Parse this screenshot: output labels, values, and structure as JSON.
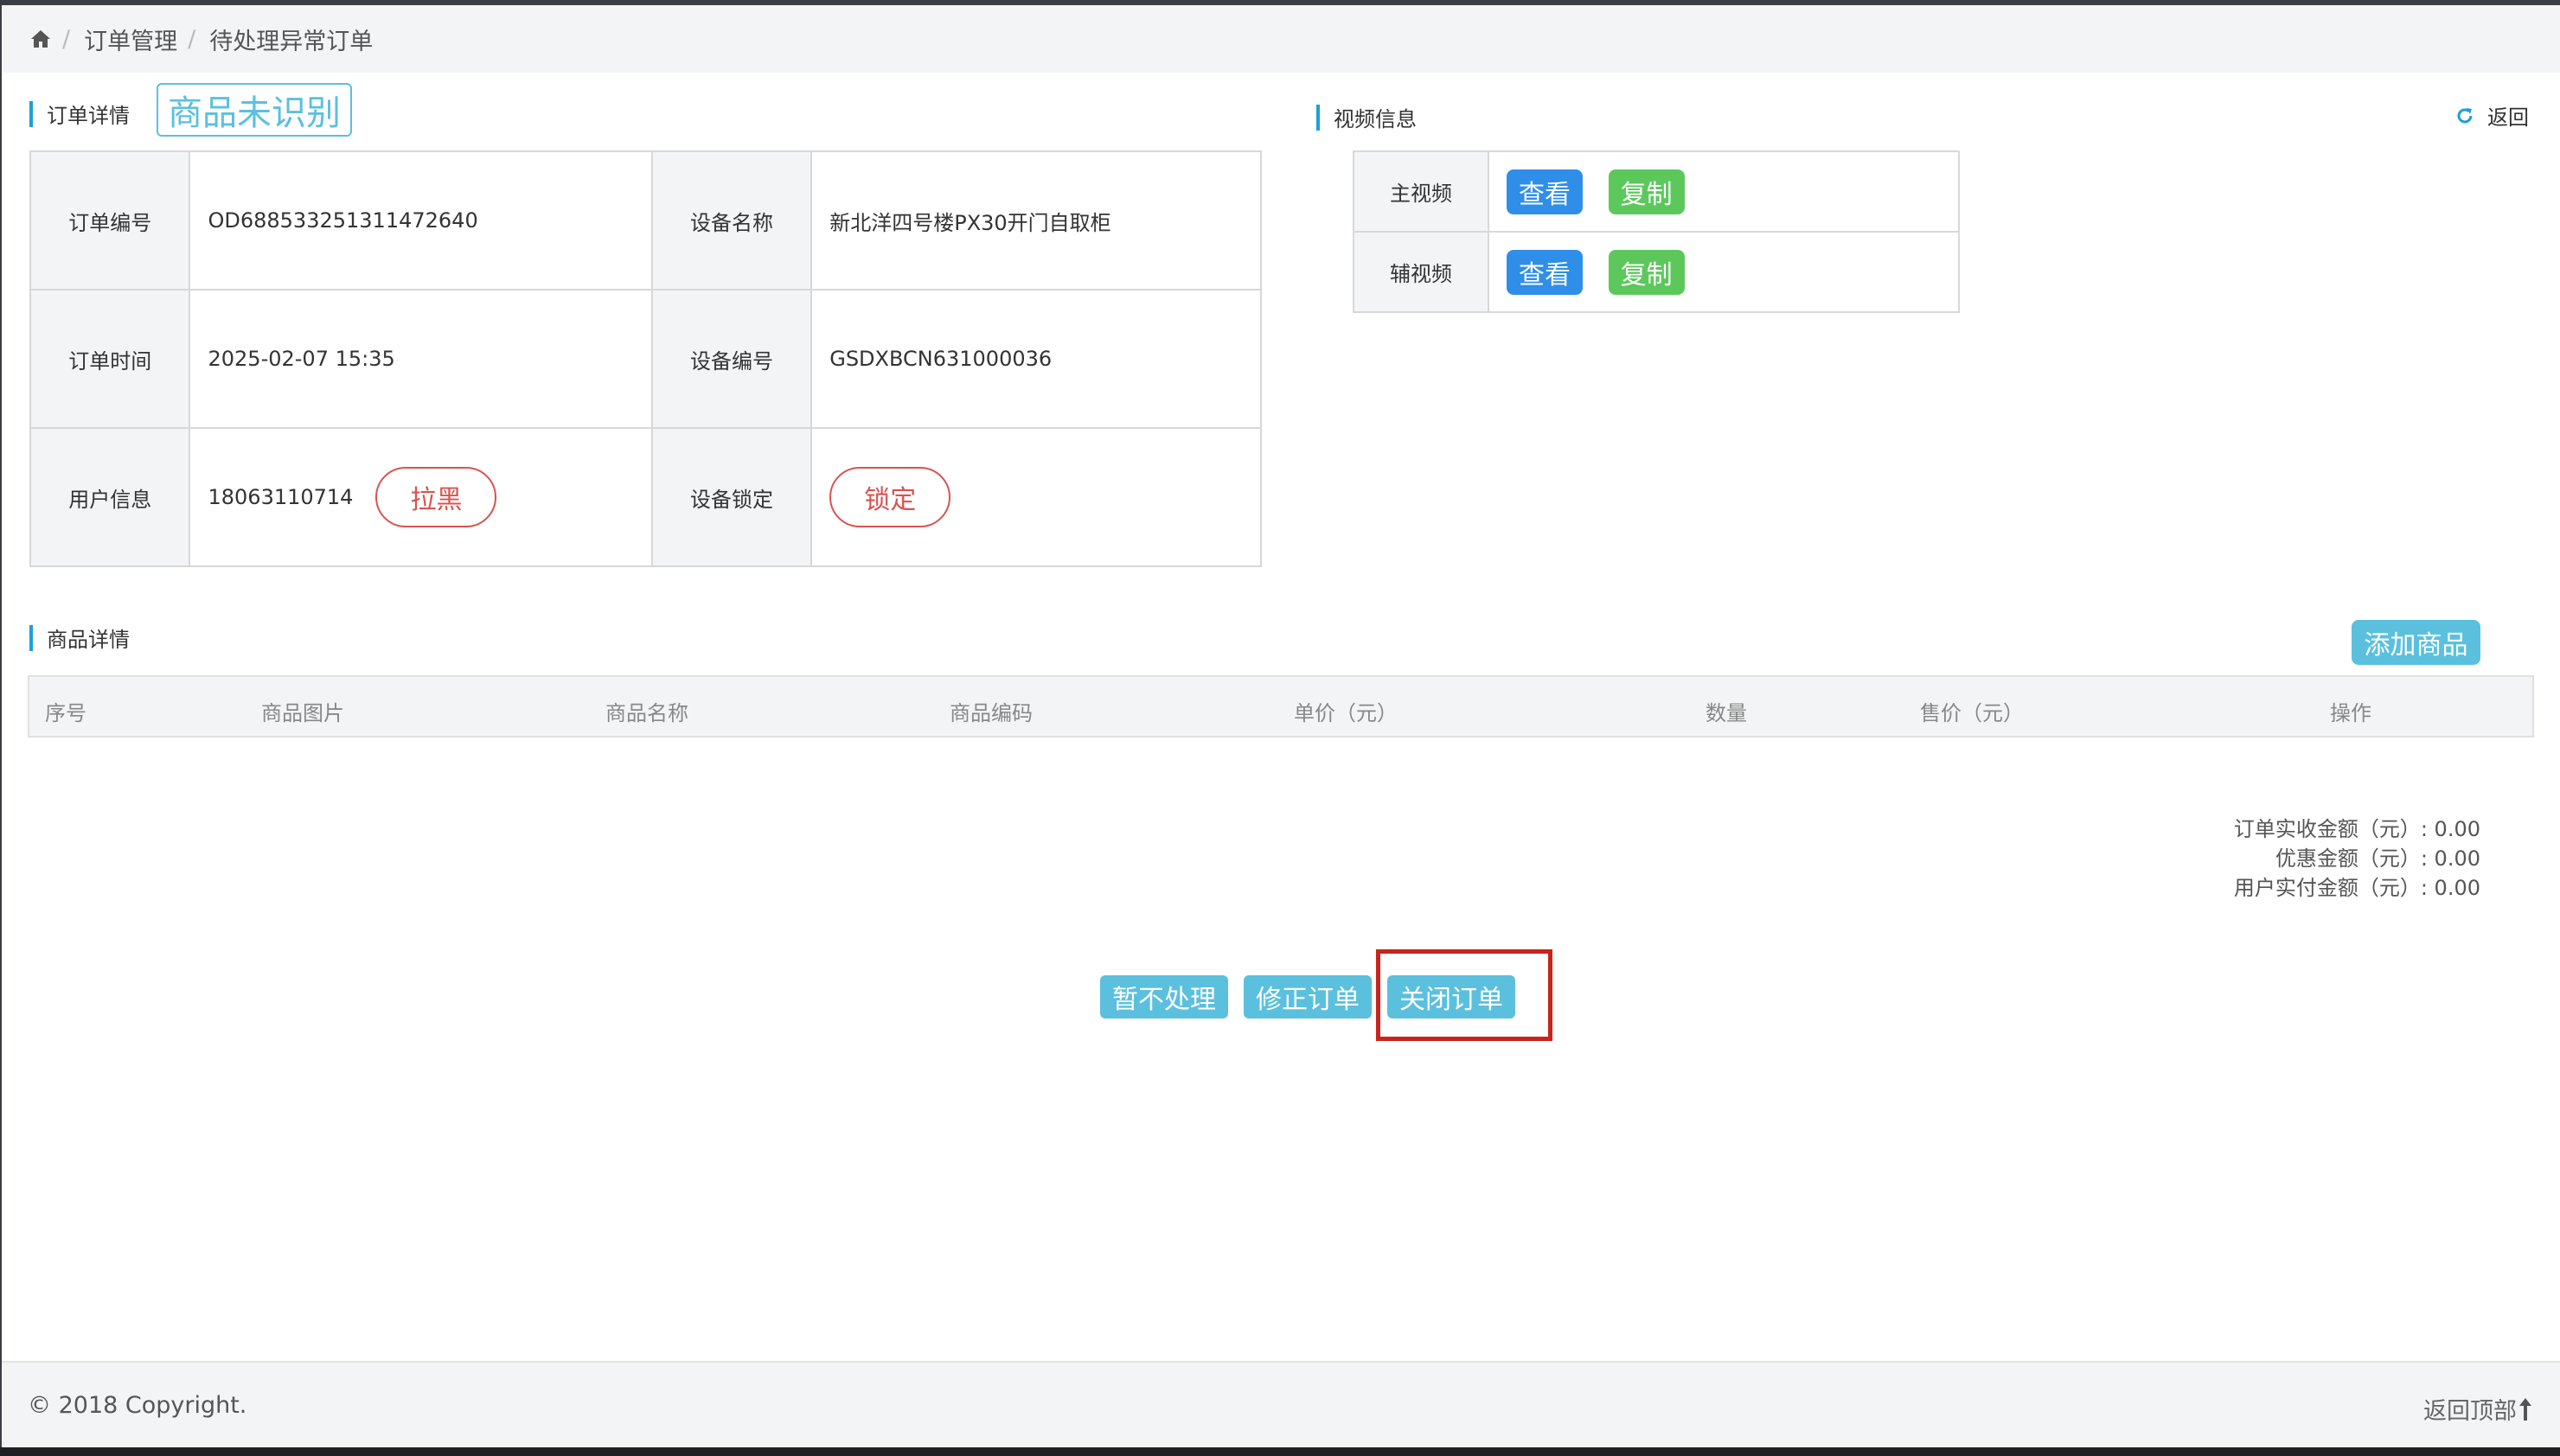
{
  "breadcrumb": {
    "items": [
      "订单管理",
      "待处理异常订单"
    ]
  },
  "order_detail": {
    "title": "订单详情",
    "status_badge": "商品未识别",
    "rows": [
      {
        "label": "订单编号",
        "value": "OD688533251311472640",
        "label2": "设备名称",
        "value2": "新北洋四号楼PX30开门自取柜"
      },
      {
        "label": "订单时间",
        "value": "2025-02-07 15:35",
        "label2": "设备编号",
        "value2": "GSDXBCN631000036"
      },
      {
        "label": "用户信息",
        "value": "18063110714",
        "action": "拉黑",
        "label2": "设备锁定",
        "action2": "锁定"
      }
    ]
  },
  "video_info": {
    "title": "视频信息",
    "back": "返回",
    "rows": [
      {
        "label": "主视频",
        "view": "查看",
        "copy": "复制"
      },
      {
        "label": "辅视频",
        "view": "查看",
        "copy": "复制"
      }
    ]
  },
  "goods": {
    "title": "商品详情",
    "add_button": "添加商品",
    "columns": [
      "序号",
      "商品图片",
      "商品名称",
      "商品编码",
      "单价（元）",
      "数量",
      "售价（元）",
      "操作"
    ],
    "rows": []
  },
  "totals": {
    "received": "订单实收金额（元）: 0.00",
    "discount": "优惠金额（元）: 0.00",
    "paid": "用户实付金额（元）: 0.00"
  },
  "actions": {
    "defer": "暂不处理",
    "fix": "修正订单",
    "close": "关闭订单"
  },
  "footer": {
    "copyright": "© 2018 Copyright.",
    "back_to_top": "返回顶部"
  },
  "colors": {
    "accent": "#5bc0de",
    "danger": "#d9534f",
    "primary": "#2f8ee8",
    "success": "#5cc85c",
    "highlight": "#c8241c"
  }
}
